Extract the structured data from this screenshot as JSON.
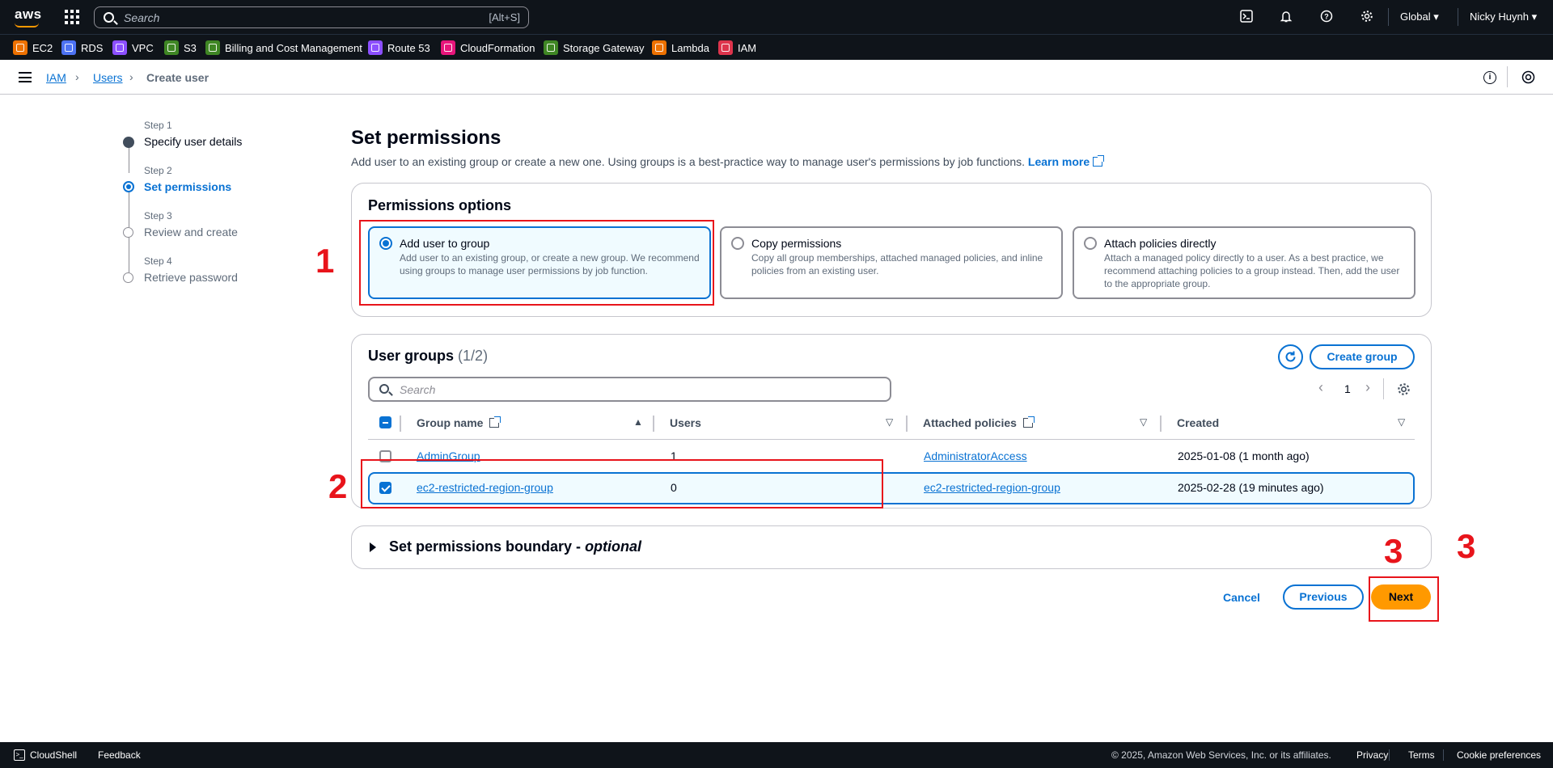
{
  "topnav": {
    "logo": "aws",
    "search_placeholder": "Search",
    "search_shortcut": "[Alt+S]",
    "region": "Global",
    "user": "Nicky Huynh"
  },
  "favorites": [
    {
      "label": "EC2",
      "color": "#ed7100"
    },
    {
      "label": "RDS",
      "color": "#4d72f3"
    },
    {
      "label": "VPC",
      "color": "#8c4fff"
    },
    {
      "label": "S3",
      "color": "#3f8624"
    },
    {
      "label": "Billing and Cost Management",
      "color": "#3f8624"
    },
    {
      "label": "Route 53",
      "color": "#8c4fff"
    },
    {
      "label": "CloudFormation",
      "color": "#e7157b"
    },
    {
      "label": "Storage Gateway",
      "color": "#3f8624"
    },
    {
      "label": "Lambda",
      "color": "#ed7100"
    },
    {
      "label": "IAM",
      "color": "#dd344c"
    }
  ],
  "breadcrumb": {
    "items": [
      "IAM",
      "Users"
    ],
    "current": "Create user"
  },
  "steps": [
    {
      "num": "Step 1",
      "label": "Specify user details"
    },
    {
      "num": "Step 2",
      "label": "Set permissions"
    },
    {
      "num": "Step 3",
      "label": "Review and create"
    },
    {
      "num": "Step 4",
      "label": "Retrieve password"
    }
  ],
  "main": {
    "title": "Set permissions",
    "description": "Add user to an existing group or create a new one. Using groups is a best-practice way to manage user's permissions by job functions.",
    "learn_more": "Learn more"
  },
  "permissions_options": {
    "title": "Permissions options",
    "options": [
      {
        "title": "Add user to group",
        "desc": "Add user to an existing group, or create a new group. We recommend using groups to manage user permissions by job function."
      },
      {
        "title": "Copy permissions",
        "desc": "Copy all group memberships, attached managed policies, and inline policies from an existing user."
      },
      {
        "title": "Attach policies directly",
        "desc": "Attach a managed policy directly to a user. As a best practice, we recommend attaching policies to a group instead. Then, add the user to the appropriate group."
      }
    ]
  },
  "user_groups": {
    "title": "User groups",
    "count": "(1/2)",
    "create_group": "Create group",
    "search_placeholder": "Search",
    "page": "1",
    "columns": [
      "Group name",
      "Users",
      "Attached policies",
      "Created"
    ],
    "rows": [
      {
        "name": "AdminGroup",
        "users": "1",
        "policy": "AdministratorAccess",
        "created": "2025-01-08 (1 month ago)",
        "selected": false
      },
      {
        "name": "ec2-restricted-region-group",
        "users": "0",
        "policy": "ec2-restricted-region-group",
        "created": "2025-02-28 (19 minutes ago)",
        "selected": true
      }
    ]
  },
  "boundary": {
    "title": "Set permissions boundary - ",
    "optional": "optional"
  },
  "actions": {
    "cancel": "Cancel",
    "previous": "Previous",
    "next": "Next"
  },
  "annotations": [
    "1",
    "2",
    "3",
    "3"
  ],
  "footer": {
    "cloudshell": "CloudShell",
    "feedback": "Feedback",
    "copyright": "© 2025, Amazon Web Services, Inc. or its affiliates.",
    "privacy": "Privacy",
    "terms": "Terms",
    "cookie": "Cookie preferences"
  }
}
